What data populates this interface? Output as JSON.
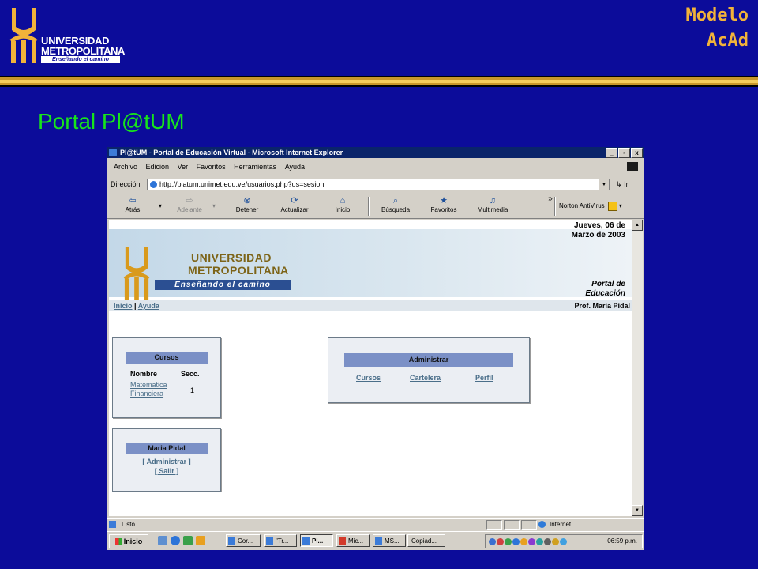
{
  "slide": {
    "logo": {
      "line1": "UNIVERSIDAD",
      "line2": "METROPOLITANA",
      "tagline": "Enseñando el camino"
    },
    "brand": {
      "line1": "Modelo",
      "line2": "AcAd"
    },
    "title": "Portal Pl@tUM",
    "colors": {
      "background": "#0c0c9a",
      "accent": "#f2b33a",
      "title": "#17e51b"
    }
  },
  "browser": {
    "window_title": "Pl@tUM - Portal de Educación Virtual - Microsoft Internet Explorer",
    "window_buttons": [
      "_",
      "▫",
      "x"
    ],
    "menu": [
      "Archivo",
      "Edición",
      "Ver",
      "Favoritos",
      "Herramientas",
      "Ayuda"
    ],
    "address_label": "Dirección",
    "url": "http://platum.unimet.edu.ve/usuarios.php?us=sesion",
    "go_label": "Ir",
    "toolbar": [
      {
        "label": "Atrás",
        "icon": "back-arrow-icon"
      },
      {
        "label": "Adelante",
        "icon": "forward-arrow-icon"
      },
      {
        "label": "Detener",
        "icon": "stop-icon"
      },
      {
        "label": "Actualizar",
        "icon": "refresh-icon"
      },
      {
        "label": "Inicio",
        "icon": "home-icon"
      },
      {
        "label": "Búsqueda",
        "icon": "search-icon"
      },
      {
        "label": "Favoritos",
        "icon": "favorites-icon"
      },
      {
        "label": "Multimedia",
        "icon": "media-icon"
      }
    ],
    "norton_label": "Norton AntiVirus",
    "status_text": "Listo",
    "zone_text": "Internet"
  },
  "page": {
    "banner": {
      "line1": "UNIVERSIDAD",
      "line2": "METROPOLITANA",
      "tagline": "Enseñando el camino",
      "date_line1": "Jueves, 06 de",
      "date_line2": "Marzo de 2003",
      "portal_line1": "Portal de",
      "portal_line2": "Educación"
    },
    "nav": {
      "home": "Inicio",
      "separator": "|",
      "help": "Ayuda",
      "professor": "Prof. Maria Pidal"
    },
    "cursos_panel": {
      "title": "Cursos",
      "col_name": "Nombre",
      "col_section": "Secc.",
      "rows": [
        {
          "name_line1": "Matematica",
          "name_line2": "Financiera",
          "section": "1"
        }
      ]
    },
    "user_panel": {
      "title": "Maria Pidal",
      "admin_link": "[ Administrar ]",
      "logout_link": "[ Salir ]"
    },
    "admin_panel": {
      "title": "Administrar",
      "links": [
        "Cursos",
        "Cartelera",
        "Perfil"
      ]
    }
  },
  "taskbar": {
    "start_label": "Inicio",
    "tasks": [
      "Cor...",
      "\"Tr...",
      "Pl...",
      "Mic...",
      "MS...",
      "Copiad..."
    ],
    "active_task": "Pl...",
    "clock": "06:59 p.m."
  }
}
